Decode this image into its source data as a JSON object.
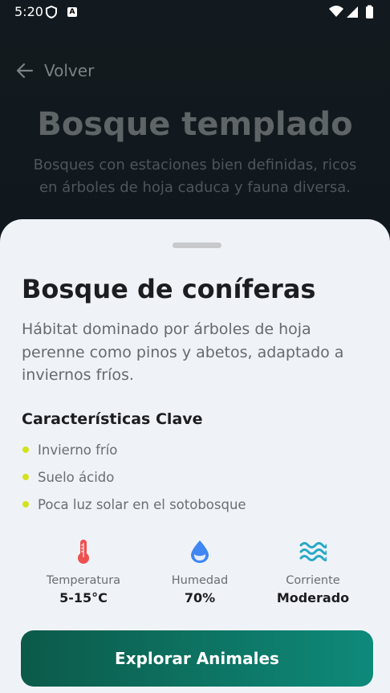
{
  "status_bar": {
    "time": "5:20",
    "icons": [
      "shield-icon",
      "text-a-icon",
      "wifi-icon",
      "signal-icon",
      "battery-icon"
    ]
  },
  "background_page": {
    "back_label": "Volver",
    "title": "Bosque templado",
    "description": "Bosques con estaciones bien definidas, ricos en árboles de hoja caduca y fauna diversa."
  },
  "sheet": {
    "title": "Bosque de coníferas",
    "description": "Hábitat dominado por árboles de hoja perenne como pinos y abetos, adaptado a inviernos fríos.",
    "section_title": "Características Clave",
    "features": [
      {
        "label": "Invierno frío"
      },
      {
        "label": "Suelo ácido"
      },
      {
        "label": "Poca luz solar en el sotobosque"
      }
    ],
    "stats": [
      {
        "label": "Temperatura",
        "value": "5-15°C",
        "icon": "thermometer-icon"
      },
      {
        "label": "Humedad",
        "value": "70%",
        "icon": "water-drop-icon"
      },
      {
        "label": "Corriente",
        "value": "Moderado",
        "icon": "waves-icon"
      }
    ],
    "cta_label": "Explorar Animales"
  },
  "colors": {
    "accent_yellow": "#d4e21d",
    "cta_start": "#0c5a49",
    "cta_end": "#0e8a7a",
    "thermometer": "#ee5050",
    "drop": "#3f86f2",
    "waves": "#27a9c6"
  }
}
